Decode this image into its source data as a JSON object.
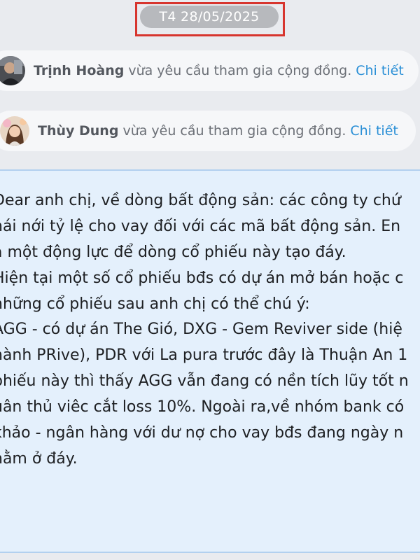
{
  "date_chip": {
    "label": "T4 28/05/2025"
  },
  "notices": [
    {
      "name": "Trịnh Hoàng",
      "action": "vừa yêu cầu tham gia cộng đồng.",
      "link": "Chi tiết"
    },
    {
      "name": "Thùy Dung",
      "action": "vừa yêu cầu tham gia cộng đồng.",
      "link": "Chi tiết"
    }
  ],
  "message": {
    "lines": [
      "Dear anh chị, về dòng bất động sản: các công ty chứ",
      "hái nới tỷ lệ cho vay đối với các mã bất động sản. En",
      "à một động lực để dòng cổ phiếu này tạo đáy.",
      "Hiện tại một số cổ phiếu bđs có dự án mở bán hoặc c",
      "những cổ phiếu sau anh chị có thể chú ý:",
      "AGG - có dự án The Gió, DXG - Gem Reviver side (hiệ",
      "hành PRive), PDR với La pura trước đây là Thuận An 1",
      "phiếu này thì thấy AGG vẫn đang có nền tích lũy tốt n",
      "uân thủ viêc cắt loss 10%. Ngoài ra,về nhóm bank có",
      "khảo - ngân hàng với dư nợ cho vay bđs đang ngày n",
      "nằm ở đáy."
    ]
  }
}
